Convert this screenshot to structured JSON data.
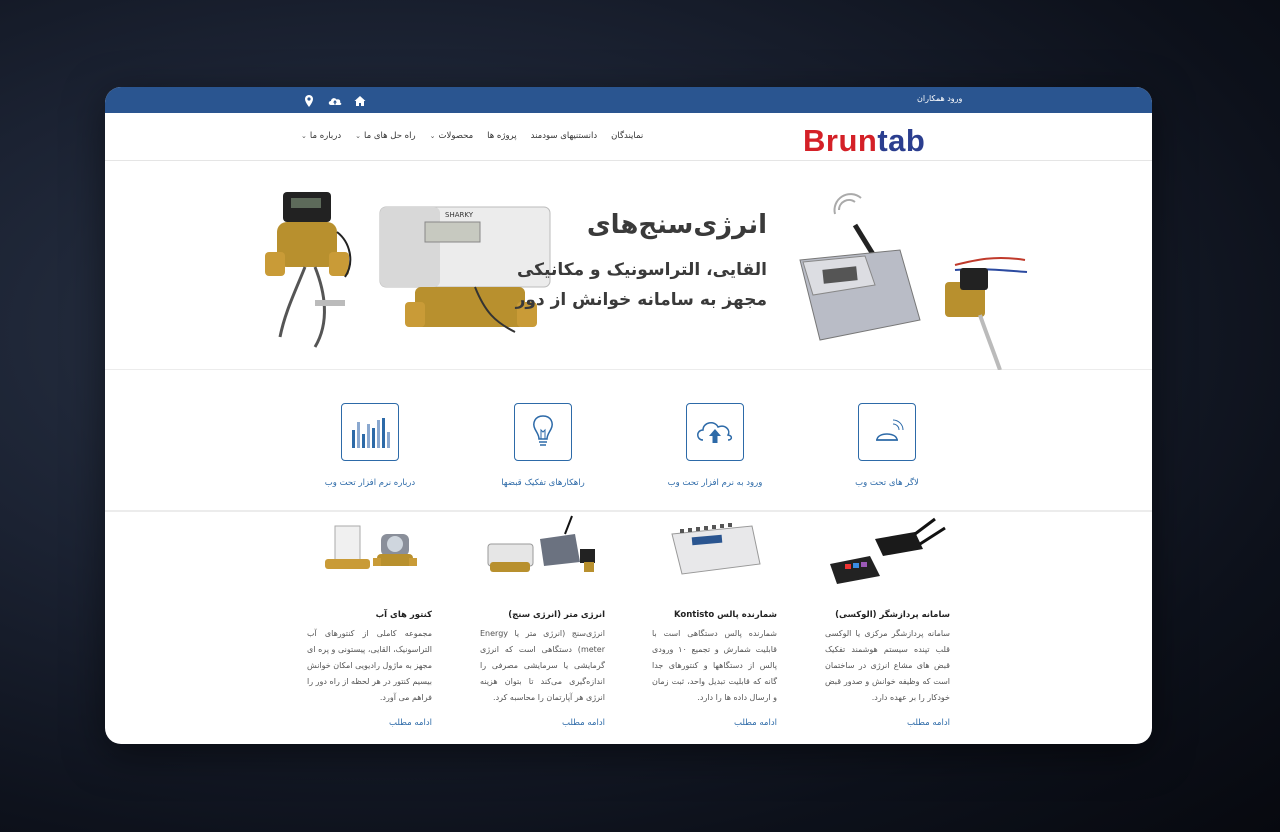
{
  "topbar": {
    "partner_login": "ورود همکاران",
    "icons": [
      "home-icon",
      "cloud-upload-icon",
      "location-pin-icon"
    ],
    "bg_color": "#2a5590"
  },
  "logo": {
    "part1": "Brun",
    "part2": "tab",
    "color1": "#d42027",
    "color2": "#2b3e8f"
  },
  "menu": [
    {
      "label": "درباره ما",
      "dropdown": true
    },
    {
      "label": "راه حل های ما",
      "dropdown": true
    },
    {
      "label": "محصولات",
      "dropdown": true
    },
    {
      "label": "پروژه ها",
      "dropdown": false
    },
    {
      "label": "دانستنیهای سودمند",
      "dropdown": false
    },
    {
      "label": "نمایندگان",
      "dropdown": false
    }
  ],
  "hero": {
    "title": "انرژی‌سنج‌های",
    "line1": "القایی، التراسونیک و مکانیکی",
    "line2": "مجهز به سامانه خوانش از دور"
  },
  "features": [
    {
      "label": "لاگر های تحت وب",
      "icon": "wireless-logger-icon"
    },
    {
      "label": "ورود به نرم افزار تحت وب",
      "icon": "cloud-upload-icon"
    },
    {
      "label": "راهکارهای تفکیک قبضها",
      "icon": "lightbulb-icon"
    },
    {
      "label": "درباره نرم افزار تحت وب",
      "icon": "bar-chart-icon"
    }
  ],
  "products": [
    {
      "title": "سامانه پردازشگر (الوکسی)",
      "desc": "سامانه پردازشگر مرکزی یا الوکسی قلب تپنده سیستم هوشمند تفکیک قبض های مشاع انرژی در ساختمان است که وظیفه خوانش و صدور قبض خودکار را بر عهده دارد.",
      "more": "ادامه مطلب"
    },
    {
      "title": "شمارنده پالس Kontisto",
      "desc": "شمارنده پالس دستگاهی است با قابلیت شمارش و تجمیع ۱۰ ورودی پالس از دستگاهها و کنتورهای جدا گانه که قابلیت تبدیل واحد، ثبت زمان و ارسال داده ها را دارد.",
      "more": "ادامه مطلب"
    },
    {
      "title": "انرژی متر (انرژی سنج)",
      "desc": "انرژی‌سنج (انرژی متر یا Energy meter) دستگاهی است که انرژی گرمایشی یا سرمایشی مصرفی را اندازه‌گیری می‌کند تا بتوان هزینه انرژی هر آپارتمان را محاسبه کرد.",
      "more": "ادامه مطلب"
    },
    {
      "title": "کنتور های آب",
      "desc": "مجموعه کاملی از کنتورهای آب التراسونیک، القایی، پیستونی و پره ای مجهز به ماژول رادیویی امکان خوانش بیسیم کنتور در هر لحظه از راه دور را فراهم می آورد.",
      "more": "ادامه مطلب"
    }
  ],
  "accent_color": "#2d6aa8"
}
